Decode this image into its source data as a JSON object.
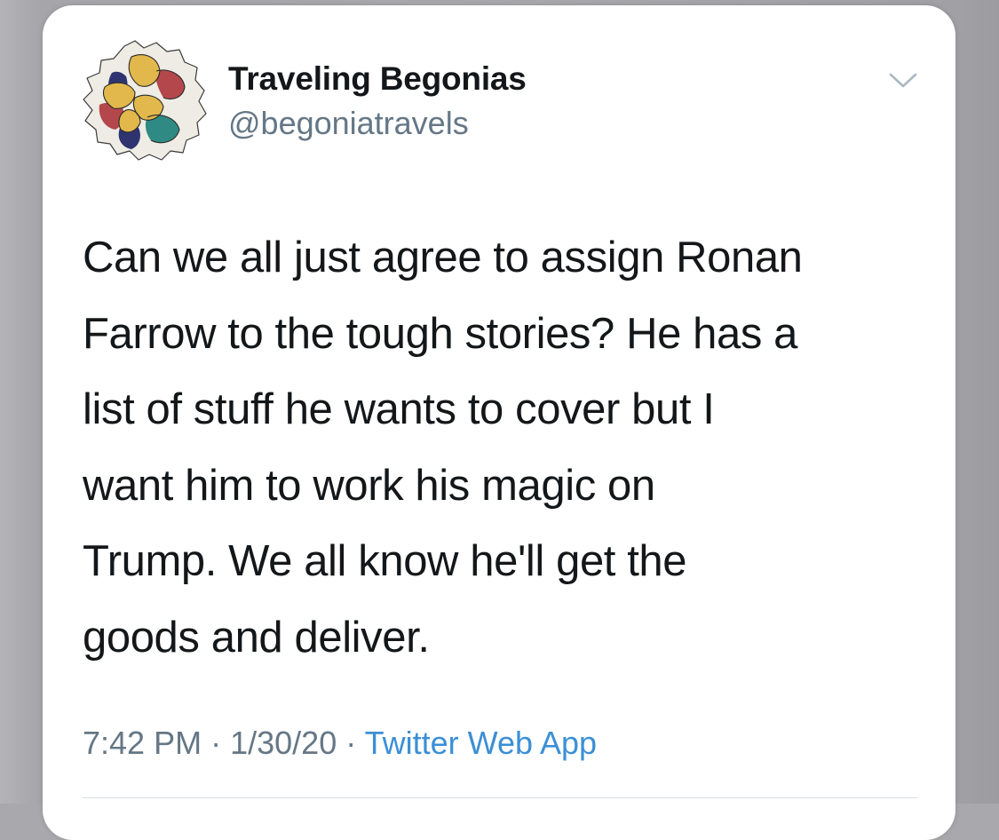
{
  "tweet": {
    "author": {
      "display_name": "Traveling Begonias",
      "handle": "@begoniatravels",
      "avatar_icon": "begonia-flower-logo"
    },
    "menu_icon": "chevron-down-icon",
    "text_lines": [
      "Can we all just agree to assign Ronan",
      "Farrow to the tough stories? He has a",
      "list of stuff he wants to cover but I",
      "want him to work his magic on",
      "Trump. We all know he'll get the",
      "goods and deliver."
    ],
    "time": "7:42 PM",
    "separator": "·",
    "date": "1/30/20",
    "source": "Twitter Web App"
  },
  "colors": {
    "text_primary": "#14171a",
    "text_secondary": "#657786",
    "link": "#3b8fd6",
    "backdrop": "#a9a9ad"
  }
}
